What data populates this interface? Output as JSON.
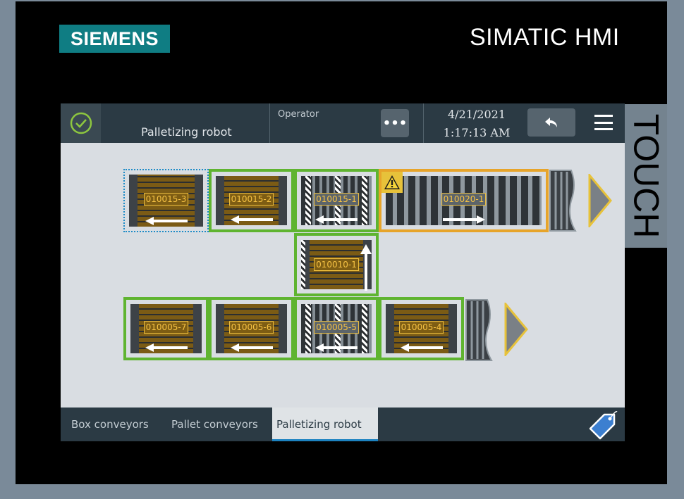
{
  "device": {
    "brand_logo": "SIEMENS",
    "product": "SIMATIC HMI",
    "touch_label": "TOUCH"
  },
  "header": {
    "status_icon": "check-circle-icon",
    "page_title": "Palletizing robot",
    "user_label": "Operator",
    "more_label": "•••",
    "date": "4/21/2021",
    "time": "1:17:13 AM",
    "back_icon": "reply-arrow-icon",
    "menu_icon": "hamburger-icon"
  },
  "conveyors": {
    "c1": {
      "id": "010015-3",
      "status": "selected",
      "direction": "left"
    },
    "c2": {
      "id": "010015-2",
      "status": "ok",
      "direction": "left"
    },
    "c3": {
      "id": "010015-1",
      "status": "ok",
      "direction": "left"
    },
    "c4": {
      "id": "010020-1",
      "status": "warning",
      "direction": "right"
    },
    "c5": {
      "id": "010010-1",
      "status": "ok",
      "direction": "up"
    },
    "c6": {
      "id": "010005-7",
      "status": "ok",
      "direction": "left"
    },
    "c7": {
      "id": "010005-6",
      "status": "ok",
      "direction": "left"
    },
    "c8": {
      "id": "010005-5",
      "status": "ok",
      "direction": "left"
    },
    "c9": {
      "id": "010005-4",
      "status": "ok",
      "direction": "left"
    }
  },
  "tabs": [
    "Box conveyors",
    "Pallet conveyors",
    "Palletizing robot"
  ],
  "active_tab": "Palletizing robot",
  "colors": {
    "ok": "#5fb430",
    "warning": "#e7a42a",
    "selected": "#1d8bc7",
    "header_bg": "#2b3a44",
    "brand": "#0f7d83"
  }
}
